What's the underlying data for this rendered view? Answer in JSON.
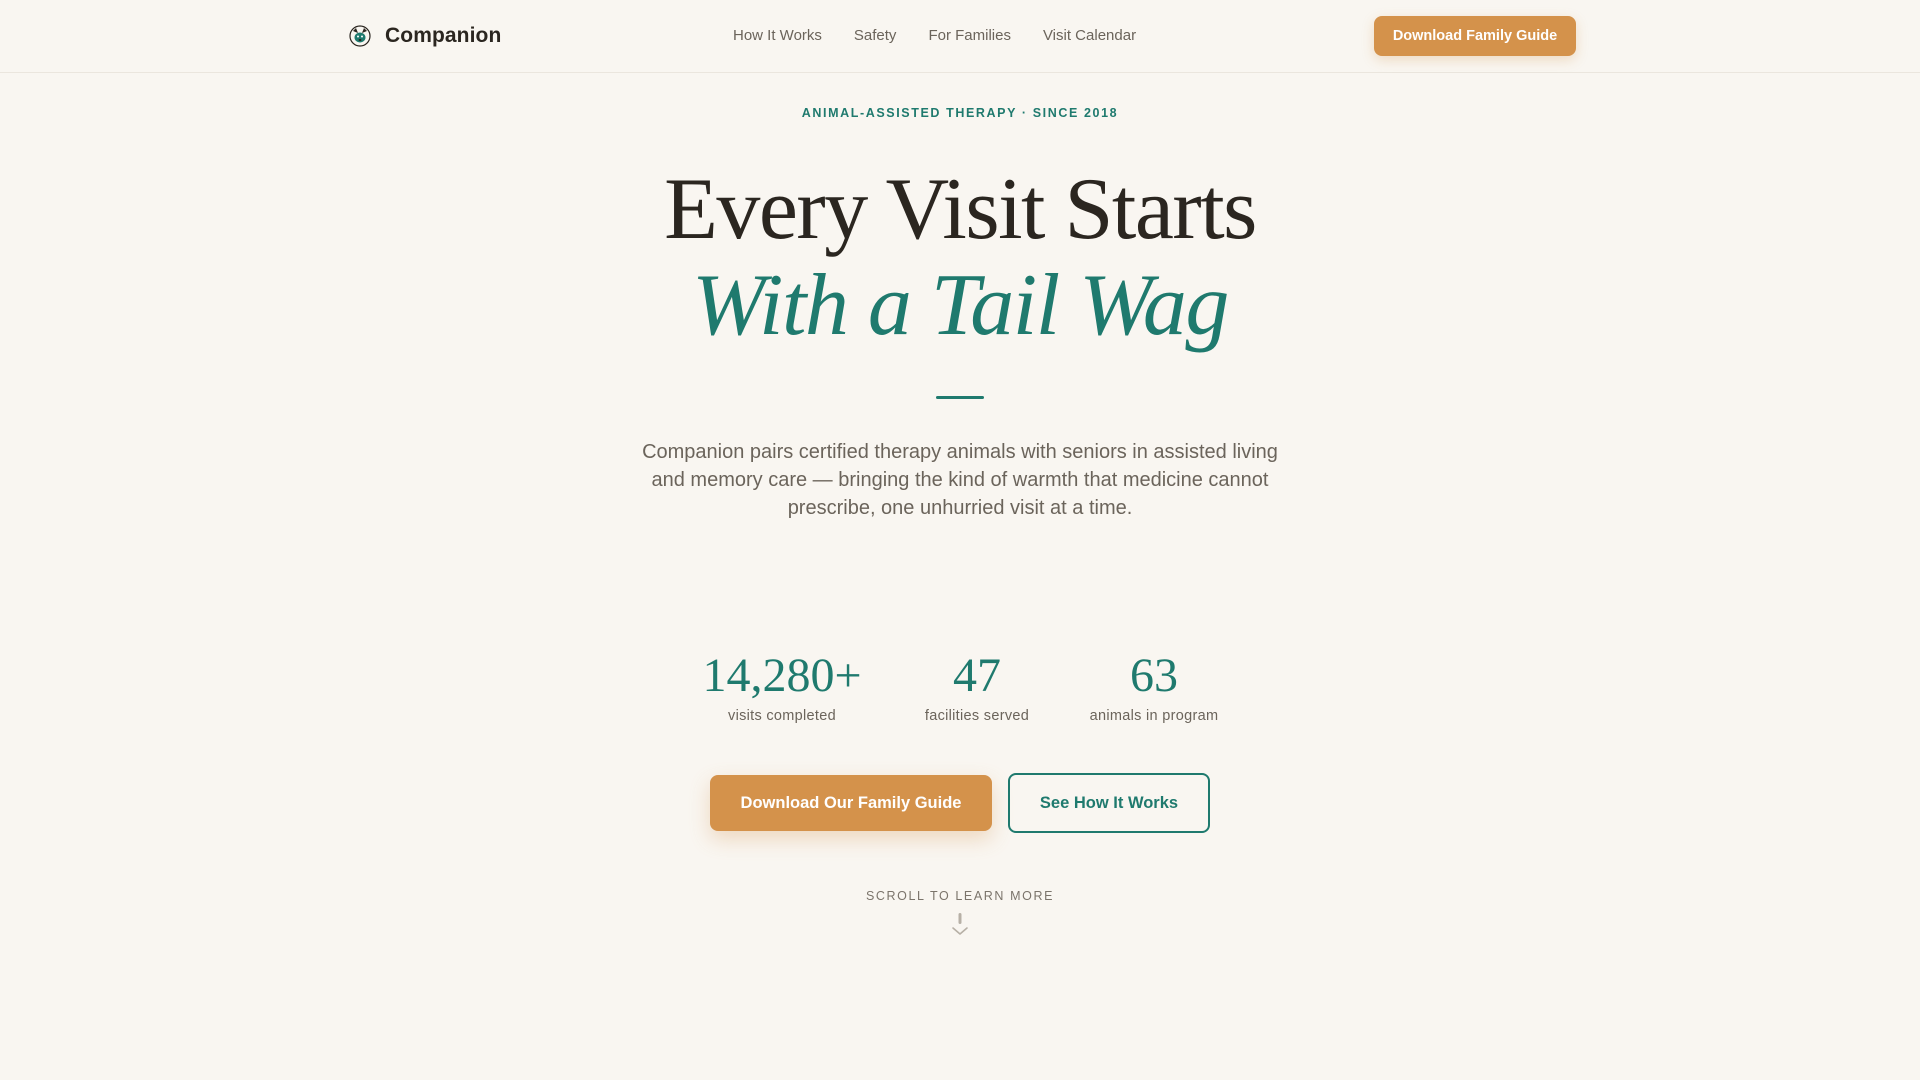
{
  "header": {
    "brand_name": "Companion",
    "brand_icon": "dog-head-icon",
    "nav": [
      {
        "label": "How It Works"
      },
      {
        "label": "Safety"
      },
      {
        "label": "For Families"
      },
      {
        "label": "Visit Calendar"
      }
    ],
    "cta_label": "Download Family Guide"
  },
  "hero": {
    "eyebrow": "ANIMAL-ASSISTED THERAPY · SINCE 2018",
    "title_line1": "Every Visit Starts",
    "title_line2": "With a Tail Wag",
    "lead": "Companion pairs certified therapy animals with seniors in assisted living and memory care — bringing the kind of warmth that medicine cannot prescribe, one unhurried visit at a time.",
    "stats": [
      {
        "value": "14,280+",
        "label": "visits completed"
      },
      {
        "value": "47",
        "label": "facilities served"
      },
      {
        "value": "63",
        "label": "animals in program"
      }
    ],
    "primary_cta": "Download Our Family Guide",
    "secondary_cta": "See How It Works",
    "scroll_hint": "SCROLL TO LEARN MORE",
    "scroll_icon": "scroll-down-arrow-icon"
  },
  "colors": {
    "background": "#f9f6f1",
    "accent_teal": "#1f7a6e",
    "accent_orange": "#d4924b",
    "text_dark": "#2b2620",
    "text_muted": "#6b645b"
  }
}
